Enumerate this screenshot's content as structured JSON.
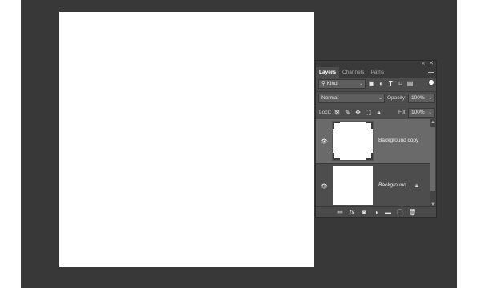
{
  "panel": {
    "tabs": [
      {
        "label": "Layers",
        "active": true
      },
      {
        "label": "Channels",
        "active": false
      },
      {
        "label": "Paths",
        "active": false
      }
    ],
    "collapse_glyph": "«",
    "close_glyph": "✕"
  },
  "filter": {
    "kind_label": "Kind",
    "icons": [
      "image-filter-icon",
      "adjustment-filter-icon",
      "type-filter-icon",
      "shape-filter-icon",
      "smart-object-filter-icon"
    ]
  },
  "blend": {
    "mode": "Normal",
    "opacity_label": "Opacity:",
    "opacity_value": "100%"
  },
  "lock": {
    "label": "Lock:",
    "fill_label": "Fill:",
    "fill_value": "100%"
  },
  "layers": [
    {
      "name": "Background copy",
      "selected": true,
      "visible": true,
      "locked": false
    },
    {
      "name": "Background",
      "selected": false,
      "visible": true,
      "locked": true
    }
  ],
  "footer_icons": [
    "link-layers-icon",
    "fx-icon",
    "add-mask-icon",
    "adjustment-layer-icon",
    "new-group-icon",
    "new-layer-icon",
    "delete-layer-icon"
  ],
  "colors": {
    "workspace": "#383838",
    "panel": "#4d4d4d",
    "selected_layer": "#6a6a6a"
  }
}
